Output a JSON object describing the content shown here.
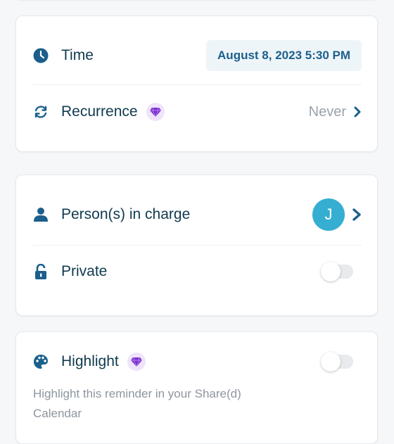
{
  "schedule": {
    "time_label": "Time",
    "time_value": "August 8, 2023 5:30 PM",
    "recurrence_label": "Recurrence",
    "recurrence_value": "Never"
  },
  "assignment": {
    "person_label": "Person(s) in charge",
    "avatar_initial": "J",
    "private_label": "Private",
    "private_enabled": false
  },
  "highlight": {
    "label": "Highlight",
    "enabled": false,
    "description": "Highlight this reminder in your Share(d) Calendar"
  },
  "colors": {
    "accent": "#1b5f8c",
    "avatar": "#35aed1",
    "premium": "#7b2fd0",
    "text": "#0f3a4f",
    "muted": "#9aa3ab"
  },
  "icons": {
    "time": "clock-icon",
    "recurrence": "refresh-icon",
    "premium": "diamond-icon",
    "person": "person-icon",
    "private": "lock-icon",
    "highlight": "palette-icon",
    "chevron": "chevron-right-icon"
  }
}
